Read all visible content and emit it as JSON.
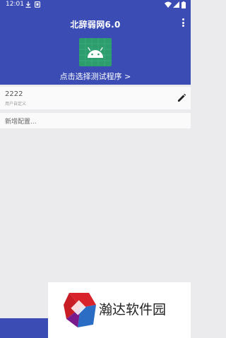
{
  "status_bar": {
    "time": "12:01"
  },
  "app_bar": {
    "title": "北辞弱网6.0",
    "select_program_link": "点击选择测试程序 >"
  },
  "config_list": [
    {
      "name": "2222",
      "subtitle": "用户自定义"
    }
  ],
  "add_config": {
    "label": "新增配置..."
  },
  "watermark": {
    "text": "瀚达软件园"
  },
  "colors": {
    "primary": "#3b4db5",
    "android_tile": "#2e9d6e"
  }
}
